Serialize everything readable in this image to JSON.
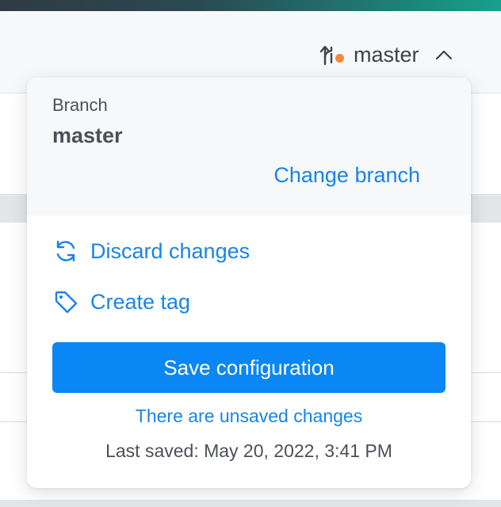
{
  "header": {
    "current_branch": "master",
    "icons": {
      "branch": "git-branch-icon",
      "status_dot": "unsaved-dot",
      "caret": "chevron-up-icon"
    }
  },
  "popover": {
    "branch_label": "Branch",
    "branch_name": "master",
    "change_branch_label": "Change branch",
    "discard_label": "Discard changes",
    "create_tag_label": "Create tag",
    "save_label": "Save configuration",
    "unsaved_text": "There are unsaved changes",
    "last_saved_text": "Last saved: May 20, 2022, 3:41 PM"
  },
  "colors": {
    "accent": "#1a83e8",
    "primary_button": "#0b86f5",
    "status_dot": "#f5873a",
    "text": "#4b5058"
  }
}
